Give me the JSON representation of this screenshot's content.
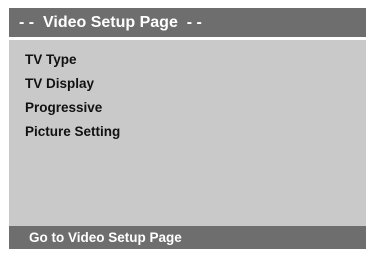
{
  "header": {
    "title": "- -  Video Setup Page  - -"
  },
  "menu": {
    "items": [
      {
        "label": "TV Type"
      },
      {
        "label": "TV Display"
      },
      {
        "label": "Progressive"
      },
      {
        "label": "Picture Setting"
      }
    ]
  },
  "footer": {
    "hint": "Go to Video Setup Page"
  }
}
